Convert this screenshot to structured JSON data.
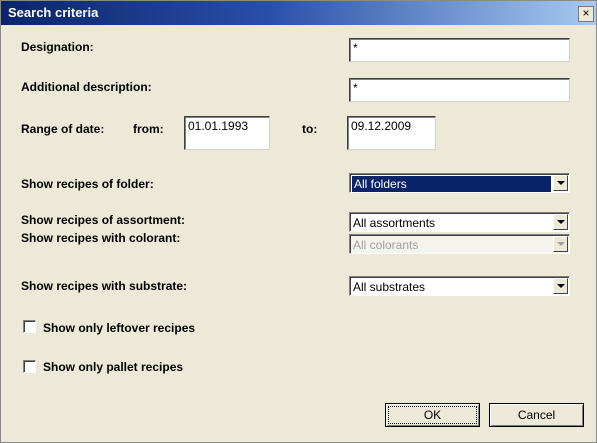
{
  "window": {
    "title": "Search criteria",
    "close_label": "×"
  },
  "fields": {
    "designation": {
      "label": "Designation:",
      "value": "*"
    },
    "additional_description": {
      "label": "Additional description:",
      "value": "*"
    },
    "range_of_date": {
      "label": "Range of date:",
      "from_label": "from:",
      "from_value": "01.01.1993",
      "to_label": "to:",
      "to_value": "09.12.2009"
    }
  },
  "dropdowns": {
    "folder": {
      "label": "Show recipes of folder:",
      "value": "All folders"
    },
    "assortment": {
      "label": "Show recipes of assortment:",
      "value": "All assortments"
    },
    "colorant": {
      "label": "Show recipes with colorant:",
      "value": "All colorants"
    },
    "substrate": {
      "label": "Show recipes with substrate:",
      "value": "All substrates"
    }
  },
  "checkboxes": {
    "leftover": {
      "label": "Show only leftover recipes",
      "checked": false
    },
    "pallet": {
      "label": "Show only pallet recipes",
      "checked": false
    }
  },
  "buttons": {
    "ok": "OK",
    "cancel": "Cancel"
  }
}
